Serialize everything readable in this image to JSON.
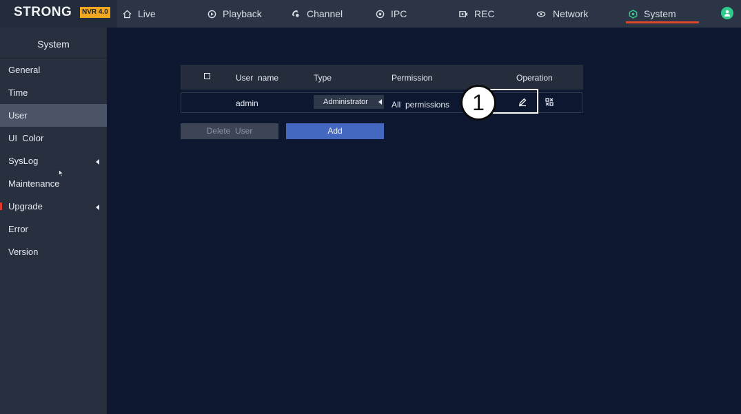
{
  "brand": {
    "name": "STRONG",
    "badge": "NVR 4.0"
  },
  "nav": [
    {
      "label": "Live",
      "icon": "home-icon"
    },
    {
      "label": "Playback",
      "icon": "playback-icon"
    },
    {
      "label": "Channel",
      "icon": "channel-icon"
    },
    {
      "label": "IPC",
      "icon": "ipc-icon"
    },
    {
      "label": "REC",
      "icon": "rec-icon"
    },
    {
      "label": "Network",
      "icon": "network-icon"
    },
    {
      "label": "System",
      "icon": "system-icon",
      "active": true
    }
  ],
  "sidebar": {
    "title": "System",
    "items": [
      {
        "label": "General"
      },
      {
        "label": "Time"
      },
      {
        "label": "User",
        "active": true
      },
      {
        "label": "UI  Color"
      },
      {
        "label": "SysLog",
        "submenu": true
      },
      {
        "label": "Maintenance"
      },
      {
        "label": "Upgrade",
        "submenu": true
      },
      {
        "label": "Error"
      },
      {
        "label": "Version"
      }
    ]
  },
  "table": {
    "headers": {
      "username": "User  name",
      "type": "Type",
      "permission": "Permission",
      "operation": "Operation"
    },
    "rows": [
      {
        "username": "admin",
        "type": "Administrator",
        "permission": "All  permissions"
      }
    ]
  },
  "buttons": {
    "delete": "Delete  User",
    "add": "Add"
  },
  "callout": {
    "number": "1"
  },
  "colors": {
    "accent": "#e0492c",
    "add_button": "#4467c0",
    "badge": "#f0a820",
    "user_icon": "#2ecb8c"
  }
}
